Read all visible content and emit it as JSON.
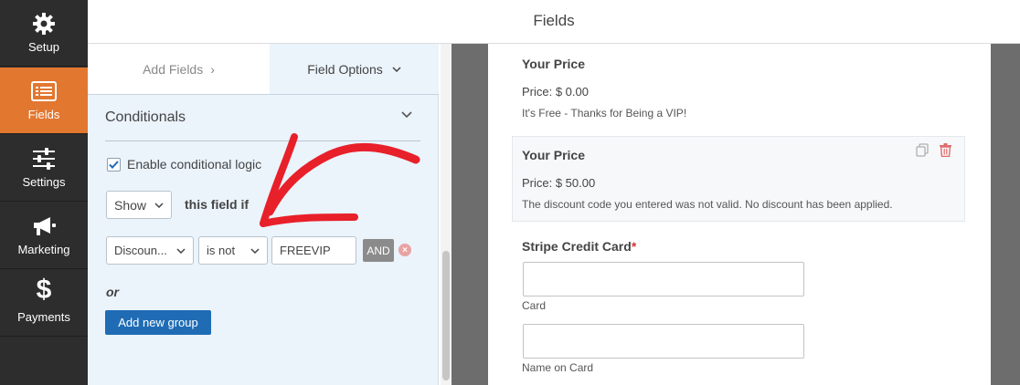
{
  "nav": {
    "items": [
      {
        "label": "Setup",
        "icon": "gear-icon",
        "active": false
      },
      {
        "label": "Fields",
        "icon": "list-icon",
        "active": true
      },
      {
        "label": "Settings",
        "icon": "sliders-icon",
        "active": false
      },
      {
        "label": "Marketing",
        "icon": "megaphone-icon",
        "active": false
      },
      {
        "label": "Payments",
        "icon": "dollar-icon",
        "active": false
      }
    ],
    "active_color": "#e27730",
    "bg_color": "#2d2d2d"
  },
  "header": {
    "title": "Fields"
  },
  "panel": {
    "tabs": {
      "add_fields": "Add Fields",
      "field_options": "Field Options"
    },
    "section_title": "Conditionals",
    "enable_label": "Enable conditional logic",
    "enable_checked": true,
    "show_select": "Show",
    "field_if_label": "this field if",
    "rule": {
      "field": "Discoun...",
      "operator": "is not",
      "value": "FREEVIP",
      "and_label": "AND"
    },
    "or_label": "or",
    "add_group_label": "Add new group",
    "accent_color": "#1f6cb5"
  },
  "preview": {
    "field1": {
      "label": "Your Price",
      "price": "Price: $ 0.00",
      "message": "It's Free - Thanks for Being a VIP!"
    },
    "field2": {
      "label": "Your Price",
      "price": "Price: $ 50.00",
      "message": "The discount code you entered was not valid. No discount has been applied."
    },
    "stripe": {
      "label": "Stripe Credit Card",
      "required_mark": "*",
      "card_sub": "Card",
      "name_sub": "Name on Card"
    }
  }
}
